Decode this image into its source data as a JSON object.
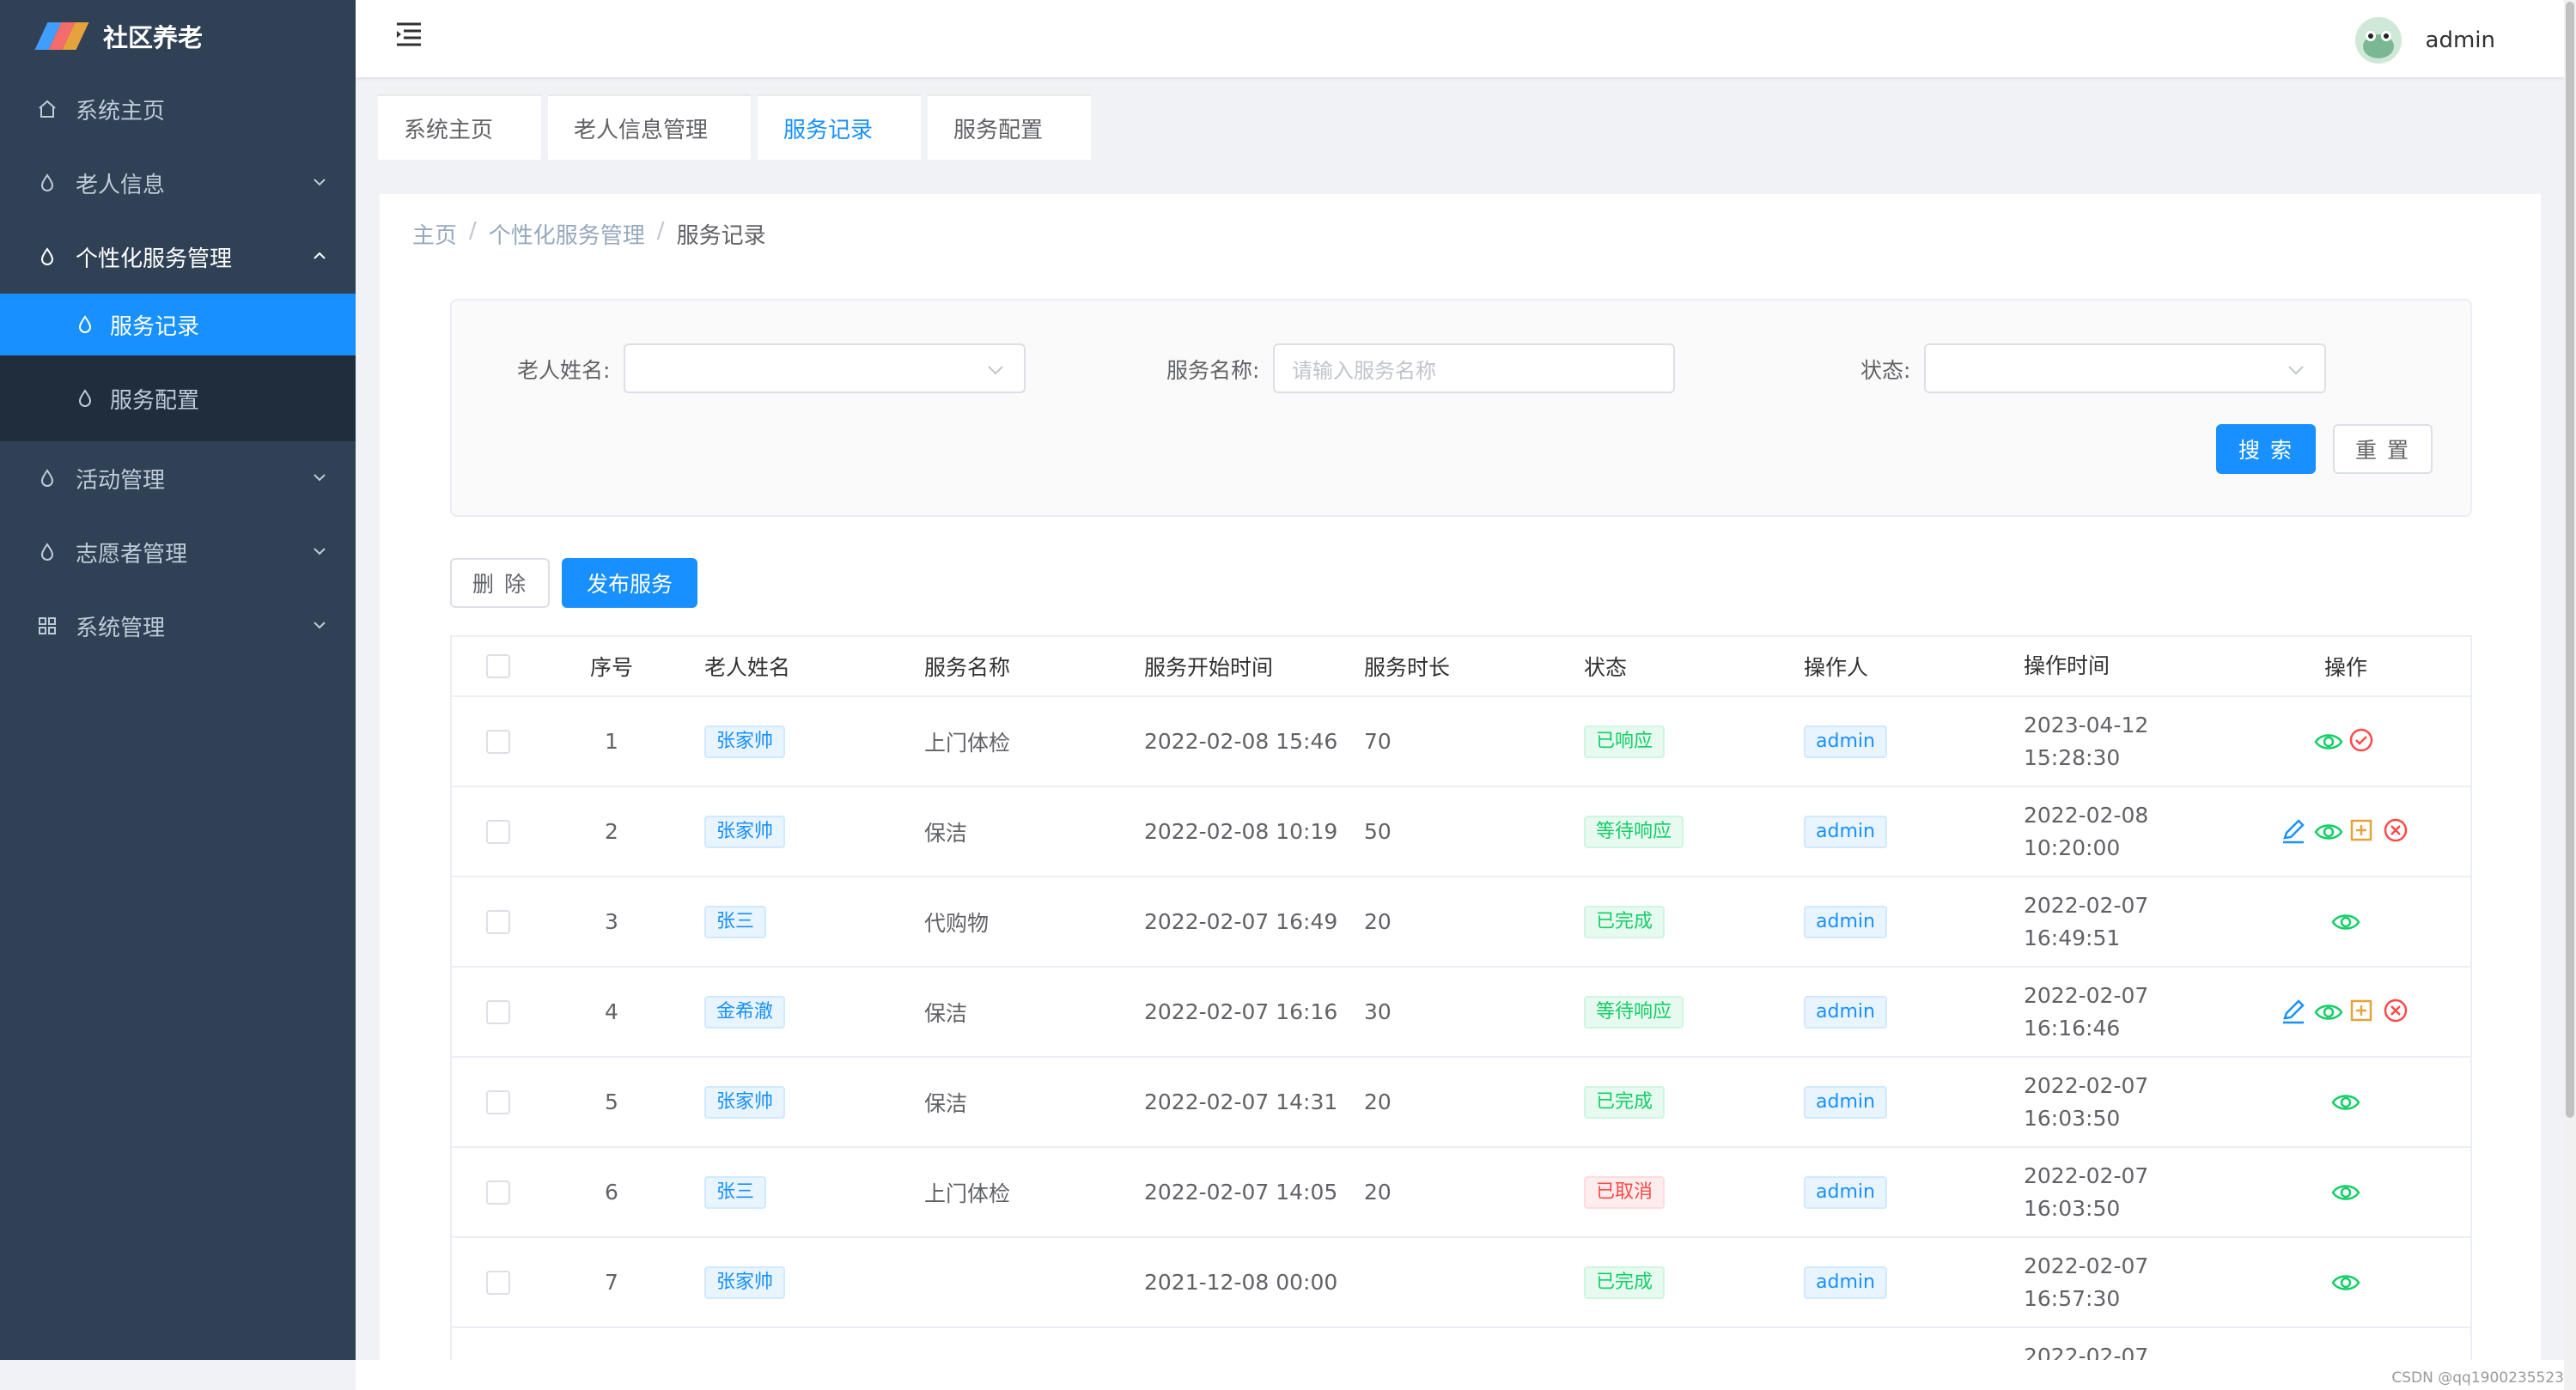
{
  "app": {
    "title": "社区养老",
    "logo_colors": [
      "#f56c6c",
      "#e6a23c",
      "#409eff"
    ]
  },
  "sidebar": {
    "items": [
      {
        "label": "系统主页",
        "icon": "home-icon"
      },
      {
        "label": "老人信息",
        "icon": "drop-icon",
        "expandable": true
      },
      {
        "label": "个性化服务管理",
        "icon": "drop-icon",
        "expanded": true
      },
      {
        "label": "服务记录",
        "icon": "drop-icon",
        "sub": true,
        "active": true
      },
      {
        "label": "服务配置",
        "icon": "drop-icon",
        "sub": true
      },
      {
        "label": "活动管理",
        "icon": "drop-icon",
        "expandable": true
      },
      {
        "label": "志愿者管理",
        "icon": "drop-icon",
        "expandable": true
      },
      {
        "label": "系统管理",
        "icon": "grid-icon",
        "expandable": true
      }
    ]
  },
  "header": {
    "username": "admin",
    "menu_icon": "hamburger-icon"
  },
  "tabs": [
    {
      "label": "系统主页"
    },
    {
      "label": "老人信息管理"
    },
    {
      "label": "服务记录",
      "active": true
    },
    {
      "label": "服务配置"
    }
  ],
  "breadcrumb": {
    "home": "主页",
    "parent": "个性化服务管理",
    "current": "服务记录"
  },
  "search": {
    "elder_label": "老人姓名:",
    "elder_value": "",
    "service_label": "服务名称:",
    "service_placeholder": "请输入服务名称",
    "status_label": "状态:",
    "status_value": "",
    "search_btn": "搜 索",
    "reset_btn": "重 置"
  },
  "actions": {
    "delete_btn": "删 除",
    "publish_btn": "发布服务"
  },
  "table": {
    "headers": [
      "序号",
      "老人姓名",
      "服务名称",
      "服务开始时间",
      "服务时长",
      "状态",
      "操作人",
      "操作时间",
      "操作"
    ],
    "rows": [
      {
        "idx": "1",
        "name": "张家帅",
        "service": "上门体检",
        "start": "2022-02-08 15:46",
        "duration": "70",
        "status": "已响应",
        "status_type": "green",
        "operator": "admin",
        "op_date": "2023-04-12",
        "op_time": "15:28:30",
        "actions": [
          "view",
          "confirm"
        ]
      },
      {
        "idx": "2",
        "name": "张家帅",
        "service": "保洁",
        "start": "2022-02-08 10:19",
        "duration": "50",
        "status": "等待响应",
        "status_type": "wait",
        "operator": "admin",
        "op_date": "2022-02-08",
        "op_time": "10:20:00",
        "actions": [
          "edit",
          "view",
          "add",
          "cancel"
        ]
      },
      {
        "idx": "3",
        "name": "张三",
        "service": "代购物",
        "start": "2022-02-07 16:49",
        "duration": "20",
        "status": "已完成",
        "status_type": "green",
        "operator": "admin",
        "op_date": "2022-02-07",
        "op_time": "16:49:51",
        "actions": [
          "view"
        ]
      },
      {
        "idx": "4",
        "name": "金希澈",
        "service": "保洁",
        "start": "2022-02-07 16:16",
        "duration": "30",
        "status": "等待响应",
        "status_type": "wait",
        "operator": "admin",
        "op_date": "2022-02-07",
        "op_time": "16:16:46",
        "actions": [
          "edit",
          "view",
          "add",
          "cancel"
        ]
      },
      {
        "idx": "5",
        "name": "张家帅",
        "service": "保洁",
        "start": "2022-02-07 14:31",
        "duration": "20",
        "status": "已完成",
        "status_type": "green",
        "operator": "admin",
        "op_date": "2022-02-07",
        "op_time": "16:03:50",
        "actions": [
          "view"
        ]
      },
      {
        "idx": "6",
        "name": "张三",
        "service": "上门体检",
        "start": "2022-02-07 14:05",
        "duration": "20",
        "status": "已取消",
        "status_type": "red",
        "operator": "admin",
        "op_date": "2022-02-07",
        "op_time": "16:03:50",
        "actions": [
          "view"
        ]
      },
      {
        "idx": "7",
        "name": "张家帅",
        "service": "",
        "start": "2021-12-08 00:00",
        "duration": "",
        "status": "已完成",
        "status_type": "green",
        "operator": "admin",
        "op_date": "2022-02-07",
        "op_time": "16:57:30",
        "actions": [
          "view"
        ]
      }
    ],
    "partial_row": {
      "op_date": "2022-02-07"
    }
  },
  "watermark": "CSDN @qq1900235523",
  "colors": {
    "primary": "#1890ff",
    "sidebar_bg": "#304156",
    "success": "#13ce66",
    "danger": "#ff4949",
    "warning": "#e6a23c"
  }
}
